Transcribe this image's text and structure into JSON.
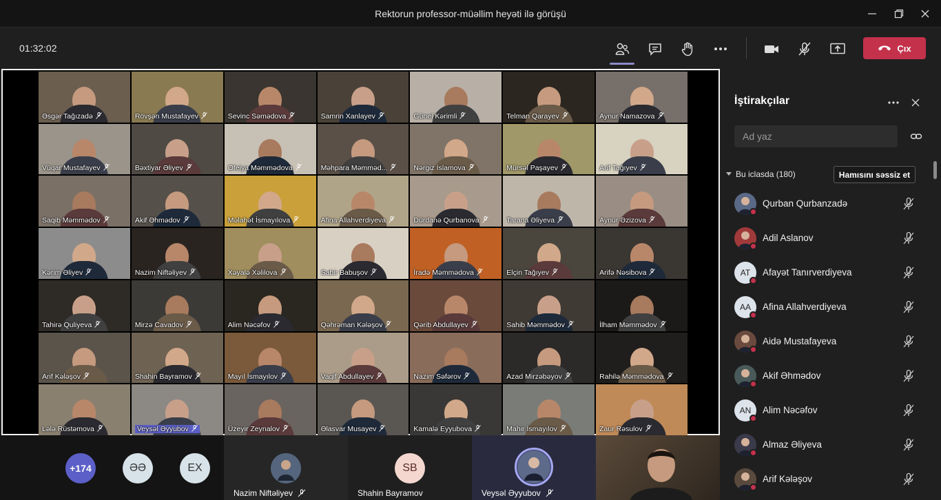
{
  "window": {
    "title": "Rektorun professor-müəllim heyəti ilə görüşü"
  },
  "toolbar": {
    "timer": "01:32:02",
    "leave_label": "Çıx"
  },
  "colors": {
    "accent": "#5b5fc7",
    "leave": "#c4314b",
    "muted_dot": "#c4314b"
  },
  "grid_names": [
    "Əsgər Tağızadə",
    "Rövşən Mustafayev",
    "Sevinc Səmədova",
    "Samrin Xanlayev",
    "Günel Kərimli",
    "Telman Qarayev",
    "Aynur Namazova",
    "Vüqar Mustafayev",
    "Bəxtiyar Əliyev",
    "Ofeiya Məmmədova",
    "Məhpara Məmməd...",
    "Nərgiz İslamova",
    "Mürsəl Paşayev",
    "Arif Tağıyev",
    "Saqib Məmmədov",
    "Akif Əhmədov",
    "Məlahət İsmayılova",
    "Afina Allahverdiyeva",
    "Dürdanə Qurbanova",
    "Tarana Əliyeva",
    "Aynur Əzizova",
    "Kərim Əliyev",
    "Nazim Niftəliyev",
    "Xəyalə Xəlilova",
    "Sabir Babuşov",
    "İradə Məmmədova",
    "Elçin Tağıyev",
    "Arifə Nəsibova",
    "Tahirə Quliyeva",
    "Mirzə Cavadov",
    "Alim Nəcəfov",
    "Qəhrəman Kələşov",
    "Qərib Abdullayev",
    "Sahib Məmmədov",
    "İlham Məmmədov",
    "Arif Kələşov",
    "Shahin Bayramov",
    "Mayıl İsmayılov",
    "Vaqif Abdullayev",
    "Nazim Səfərov",
    "Azad Mirzəbəyov",
    "Rahilə Məmmədova",
    "Lələ Rüstəmova",
    "Veysəl Əyyubov",
    "Üzeyir Zeynalov",
    "Əlasvar Musayev",
    "Kamalə Eyyubova",
    "Mahir İsmayılov",
    "Zaur Rəsulov"
  ],
  "bottom_strip": {
    "overflow": "+174",
    "bubbles": [
      "ƏƏ",
      "EX"
    ],
    "tiles": [
      "Nazim Niftəliyev",
      "Shahin Bayramov",
      "Veysəl Əyyubov"
    ],
    "sb_initials": "SB"
  },
  "panel": {
    "title": "İştirakçılar",
    "search_placeholder": "Ad yaz",
    "section": "Bu iclasda (180)",
    "mute_all": "Hamısını səssiz et",
    "participants": [
      {
        "name": "Qurban Qurbanzadə",
        "initials": "",
        "photo": true
      },
      {
        "name": "Adil Aslanov",
        "initials": "",
        "photo": true
      },
      {
        "name": "Afayət Tanırverdiyeva",
        "initials": "AT",
        "photo": false
      },
      {
        "name": "Afina Allahverdiyeva",
        "initials": "AA",
        "photo": false
      },
      {
        "name": "Aidə Mustafayeva",
        "initials": "",
        "photo": true
      },
      {
        "name": "Akif Əhmədov",
        "initials": "",
        "photo": true
      },
      {
        "name": "Alim Nəcəfov",
        "initials": "AN",
        "photo": false
      },
      {
        "name": "Almaz Əliyeva",
        "initials": "",
        "photo": true
      },
      {
        "name": "Arif Kələşov",
        "initials": "",
        "photo": true
      }
    ]
  }
}
